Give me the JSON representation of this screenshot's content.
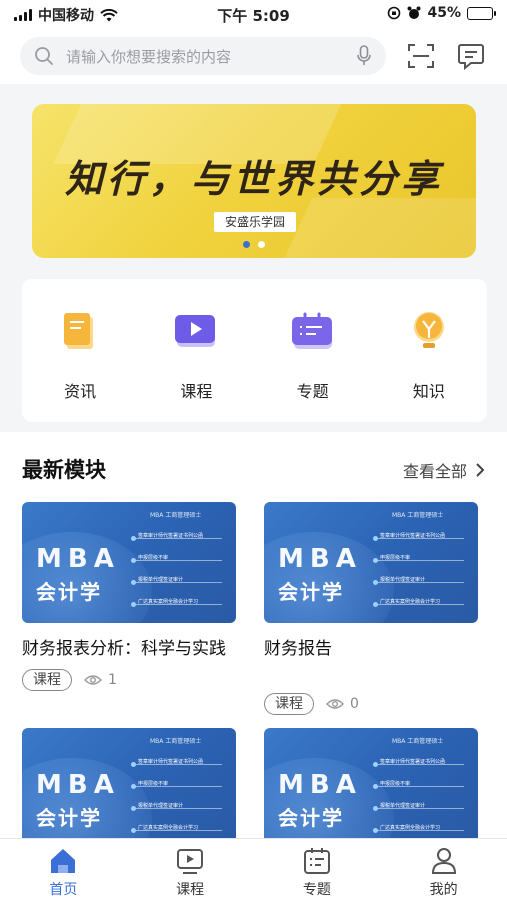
{
  "status_bar": {
    "carrier": "中国移动",
    "time": "下午 5:09",
    "battery_text": "45%",
    "battery_level": 0.45
  },
  "search": {
    "placeholder": "请输入你想要搜索的内容"
  },
  "banner": {
    "title": "知行，与世界共分享",
    "subtitle": "安盛乐学园",
    "slide_count": 2,
    "active_slide": 1
  },
  "categories": [
    {
      "label": "资讯",
      "icon": "document-icon",
      "color": "#f5b63b"
    },
    {
      "label": "课程",
      "icon": "video-play-icon",
      "color": "#6e5ce8"
    },
    {
      "label": "专题",
      "icon": "list-board-icon",
      "color": "#7b66ea"
    },
    {
      "label": "知识",
      "icon": "lightbulb-icon",
      "color": "#f5b63b"
    }
  ],
  "section": {
    "title": "最新模块",
    "more_label": "查看全部"
  },
  "modules": [
    {
      "title": "财务报表分析：科学与实践",
      "tag": "课程",
      "views": "1",
      "thumb": {
        "top_tag": "MBA 工商管理硕士",
        "mba": "MBA",
        "subject": "会计学",
        "rows": [
          "签章审计师代签署证书列公函",
          "申报层级不审",
          "报税单代理签证审计",
          "广达真实案例全融会计学习"
        ]
      }
    },
    {
      "title": "财务报告",
      "tag": "课程",
      "views": "0",
      "thumb": {
        "top_tag": "MBA 工商管理硕士",
        "mba": "MBA",
        "subject": "会计学",
        "rows": [
          "签章审计师代签署证书列公函",
          "申报层级不审",
          "报税单代理签证审计",
          "广达真实案例全融会计学习"
        ]
      }
    },
    {
      "title": "",
      "tag": "",
      "views": "",
      "thumb": {
        "top_tag": "MBA 工商管理硕士",
        "mba": "MBA",
        "subject": "会计学",
        "rows": [
          "签章审计师代签署证书列公函",
          "申报层级不审",
          "报税单代理签证审计",
          "广达真实案例全融会计学习"
        ]
      }
    },
    {
      "title": "",
      "tag": "",
      "views": "",
      "thumb": {
        "top_tag": "MBA 工商管理硕士",
        "mba": "MBA",
        "subject": "会计学",
        "rows": [
          "签章审计师代签署证书列公函",
          "申报层级不审",
          "报税单代理签证审计",
          "广达真实案例全融会计学习"
        ]
      }
    }
  ],
  "tabbar": [
    {
      "label": "首页",
      "icon": "home-icon",
      "active": true
    },
    {
      "label": "课程",
      "icon": "video-play-icon",
      "active": false
    },
    {
      "label": "专题",
      "icon": "list-board-icon",
      "active": false
    },
    {
      "label": "我的",
      "icon": "user-icon",
      "active": false
    }
  ],
  "colors": {
    "accent": "#3b6fd6",
    "banner_yellow": "#f1d33f",
    "thumb_blue": "#2b62b3"
  }
}
